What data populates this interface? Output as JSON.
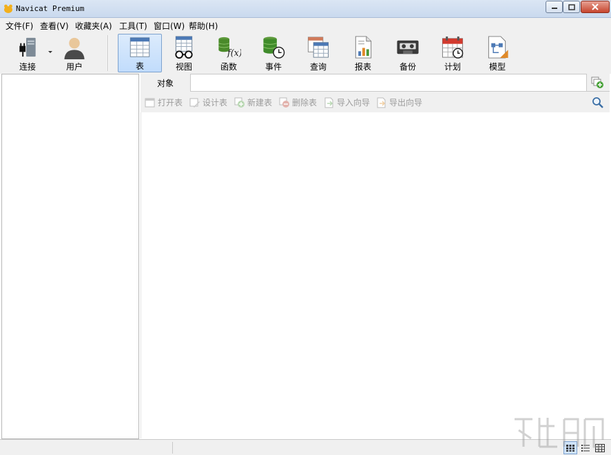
{
  "window": {
    "title": "Navicat Premium"
  },
  "menu": {
    "items": [
      "文件(F)",
      "查看(V)",
      "收藏夹(A)",
      "工具(T)",
      "窗口(W)",
      "帮助(H)"
    ]
  },
  "toolbar": {
    "connect": "连接",
    "user": "用户",
    "table": "表",
    "view": "视图",
    "function": "函数",
    "event": "事件",
    "query": "查询",
    "report": "报表",
    "backup": "备份",
    "schedule": "计划",
    "model": "模型"
  },
  "tabs": {
    "objects": "对象"
  },
  "object_toolbar": {
    "open_table": "打开表",
    "design_table": "设计表",
    "new_table": "新建表",
    "delete_table": "删除表",
    "import_wizard": "导入向导",
    "export_wizard": "导出向导"
  },
  "colors": {
    "accent": "#c1dcfc",
    "disabled_text": "#9b9b9b",
    "panel_bg": "#f0f0f0"
  },
  "icons": {
    "connect": "plug-server-icon",
    "user": "user-icon",
    "table": "table-icon",
    "view": "glasses-table-icon",
    "function": "function-db-icon",
    "event": "clock-db-icon",
    "query": "query-table-icon",
    "report": "report-chart-icon",
    "backup": "tape-backup-icon",
    "schedule": "calendar-icon",
    "model": "model-diagram-icon"
  },
  "status_bar": {
    "view_modes": [
      "grid-view",
      "list-view",
      "detail-view"
    ]
  }
}
